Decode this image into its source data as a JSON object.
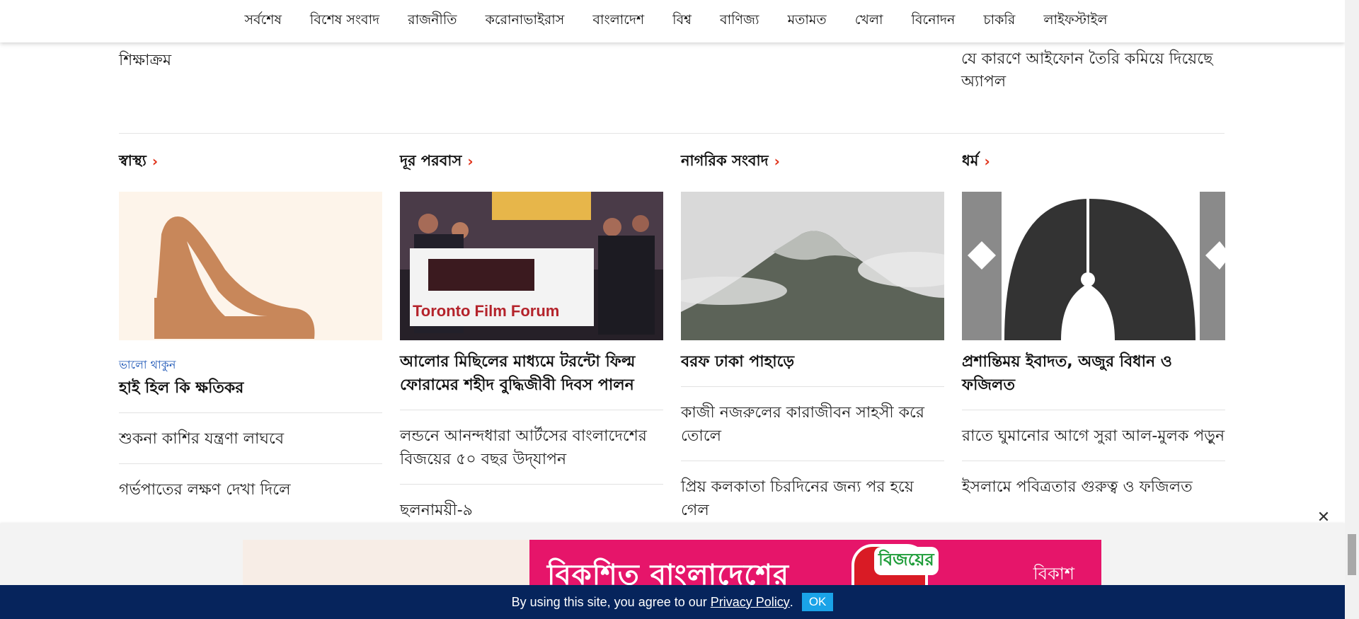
{
  "nav": {
    "items": [
      "সর্বশেষ",
      "বিশেষ সংবাদ",
      "রাজনীতি",
      "করোনাভাইরাস",
      "বাংলাদেশ",
      "বিশ্ব",
      "বাণিজ্য",
      "মতামত",
      "খেলা",
      "বিনোদন",
      "চাকরি",
      "লাইফস্টাইল"
    ]
  },
  "previous_row": {
    "left_text": "শিক্ষাক্রম",
    "right_text": "যে কারণে আইফোন তৈরি কমিয়ে দিয়েছে অ্যাপল"
  },
  "sections": [
    {
      "title": "স্বাস্থ্য",
      "kicker": "ভালো থাকুন",
      "lead": "হাই হিল কি ক্ষতিকর",
      "stories": [
        "শুকনা কাশির যন্ত্রণা লাঘবে",
        "গর্ভপাতের লক্ষণ দেখা দিলে"
      ]
    },
    {
      "title": "দূর পরবাস",
      "kicker": "",
      "lead": "আলোর মিছিলের মাধ্যমে টরন্টো ফিল্ম ফোরামের শহীদ বুদ্ধিজীবী দিবস পালন",
      "banner_text": "Toronto Film Forum",
      "stories": [
        "লন্ডনে আনন্দধারা আর্টসের বাংলাদেশের বিজয়ের ৫০ বছর উদ্‌যাপন",
        "ছলনাময়ী-৯"
      ]
    },
    {
      "title": "নাগরিক সংবাদ",
      "kicker": "",
      "lead": "বরফ ঢাকা পাহাড়ে",
      "stories": [
        "কাজী নজরুলের কারাজীবন সাহসী করে তোলে",
        "প্রিয় কলকাতা চিরদিনের জন্য পর হয়ে গেল"
      ]
    },
    {
      "title": "ধর্ম",
      "kicker": "",
      "lead": "প্রশান্তিময় ইবাদত, অজুর বিধান ও ফজিলত",
      "stories": [
        "রাতে ঘুমানোর আগে সুরা আল-মুলক পড়ুন",
        "ইসলামে পবিত্রতার গুরুত্ব ও ফজিলত"
      ]
    }
  ],
  "ad": {
    "headline": "বিকশিত বাংলাদেশের",
    "badge": "বিজয়ের",
    "brand": "বিকাশ"
  },
  "cookie": {
    "text_before": "By using this site, you agree to our ",
    "link": "Privacy Policy",
    "text_after": ".",
    "button": "OK"
  },
  "colors": {
    "accent": "#e0331a",
    "kicker": "#1d56b6",
    "cookie_bg": "#06245c",
    "ok_button": "#1aa3e8",
    "ad_bg": "#e6156a"
  },
  "icons": [
    "chevron-right-icon",
    "close-icon"
  ]
}
